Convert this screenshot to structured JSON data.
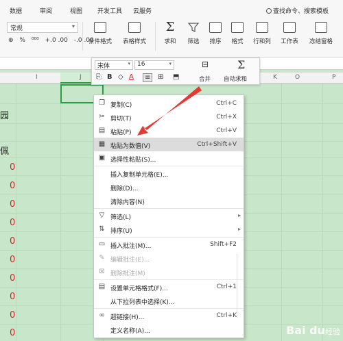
{
  "tabs": [
    "数据",
    "审阅",
    "视图",
    "开发工具",
    "云服务"
  ],
  "search": {
    "label": "查找命令、搜索模板"
  },
  "ribbon": {
    "number_format": "常规",
    "mini_tools": [
      "⊕",
      "%",
      "⁰⁰⁰",
      "+.0 .00",
      "-.0 .00"
    ],
    "buttons": [
      "条件格式",
      "表格样式",
      "求和",
      "筛选",
      "排序",
      "格式",
      "行和列",
      "工作表",
      "冻结窗格"
    ]
  },
  "columns": [
    "I",
    "J",
    "K",
    "O",
    "P"
  ],
  "left_texts": [
    "园",
    "佩"
  ],
  "zero_value": "0",
  "zero_count": 10,
  "mini_toolbar": {
    "font": "宋体",
    "size": "16",
    "merge": "合并",
    "autosum": "自动求和"
  },
  "context_menu": [
    {
      "label": "复制(C)",
      "shortcut": "Ctrl+C",
      "icon": "copy-icon"
    },
    {
      "label": "剪切(T)",
      "shortcut": "Ctrl+X",
      "icon": "cut-icon"
    },
    {
      "label": "粘贴(P)",
      "shortcut": "Ctrl+V",
      "icon": "paste-icon"
    },
    {
      "label": "粘贴为数值(V)",
      "shortcut": "Ctrl+Shift+V",
      "icon": "paste-values-icon",
      "highlight": true
    },
    {
      "label": "选择性粘贴(S)...",
      "shortcut": "",
      "icon": "paste-special-icon"
    },
    {
      "label": "插入复制单元格(E)...",
      "shortcut": "",
      "icon": ""
    },
    {
      "label": "删除(D)...",
      "shortcut": "",
      "icon": ""
    },
    {
      "label": "清除内容(N)",
      "shortcut": "",
      "icon": ""
    },
    {
      "label": "筛选(L)",
      "shortcut": "",
      "icon": "filter-icon",
      "submenu": true
    },
    {
      "label": "排序(U)",
      "shortcut": "",
      "icon": "sort-icon",
      "submenu": true
    },
    {
      "label": "插入批注(M)...",
      "shortcut": "Shift+F2",
      "icon": "comment-icon"
    },
    {
      "label": "编辑批注(E)...",
      "shortcut": "",
      "icon": "edit-comment-icon",
      "disabled": true
    },
    {
      "label": "删除批注(M)",
      "shortcut": "",
      "icon": "delete-comment-icon",
      "disabled": true
    },
    {
      "label": "设置单元格格式(F)...",
      "shortcut": "Ctrl+1",
      "icon": "format-cells-icon"
    },
    {
      "label": "从下拉列表中选择(K)...",
      "shortcut": "",
      "icon": ""
    },
    {
      "label": "超链接(H)...",
      "shortcut": "Ctrl+K",
      "icon": "link-icon"
    },
    {
      "label": "定义名称(A)...",
      "shortcut": "",
      "icon": ""
    }
  ],
  "watermark": {
    "brand": "Bai du",
    "suffix": "经验"
  },
  "colors": {
    "sheet_bg": "#c8e6c9",
    "arrow": "#e53935",
    "zero_text": "#c62828",
    "selection": "#2e9b46"
  }
}
